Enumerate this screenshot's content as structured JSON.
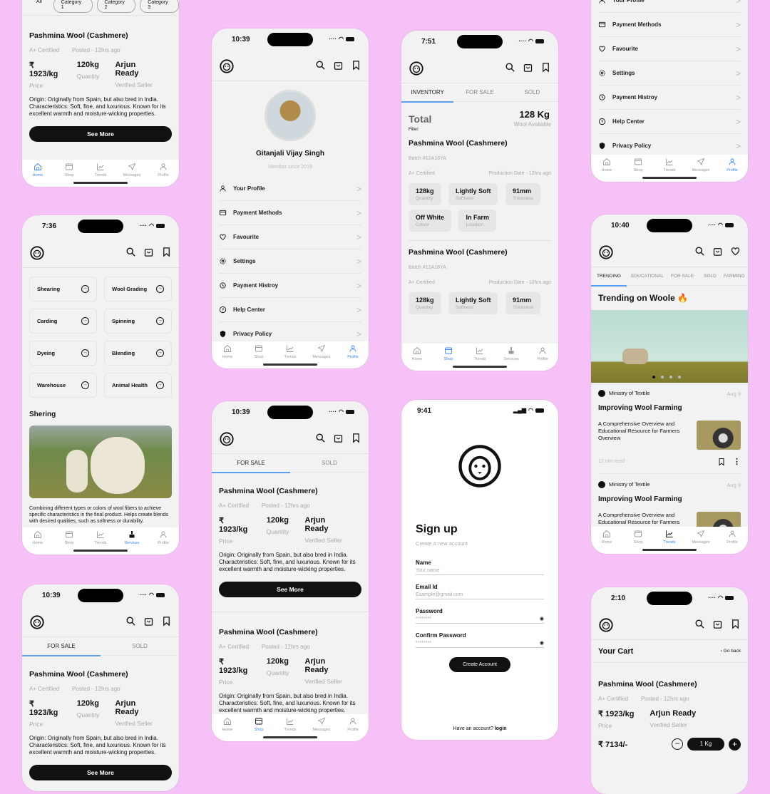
{
  "background_color": "#f6c1f6",
  "accent_color": "#3a86ff",
  "common": {
    "product_title": "Pashmina Wool (Cashmere)",
    "certified": "A+ Certified",
    "posted": "Posted - 12hrs ago",
    "price": "₹ 1923/kg",
    "price_label": "Price",
    "quantity": "120kg",
    "quantity_label": "Quantity",
    "seller": "Arjun Ready",
    "seller_label": "Verified Seller",
    "description": "Origin: Originally from Spain, but also bred in India. Characteristics: Soft, fine, and luxurious. Known for its excellent warmth and moisture-wicking properties.",
    "see_more": "See More",
    "nav": [
      "Home",
      "Shop",
      "Trends",
      "Messages",
      "Profile"
    ],
    "nav_services": [
      "Home",
      "Shop",
      "Trends",
      "Services",
      "Profile"
    ]
  },
  "home_screen": {
    "filter_chips": [
      "All",
      "Category 1",
      "Category 2",
      "Category 3"
    ],
    "active_nav": "Home"
  },
  "profile_screen": {
    "time": "10:39",
    "user_name": "Gitanjali Vijay Singh",
    "member_since": "Member since 2019",
    "menu": [
      "Your Profile",
      "Payment Methods",
      "Favourite",
      "Settings",
      "Payment Histroy",
      "Help Center",
      "Privacy Policy"
    ],
    "active_nav": "Profile"
  },
  "inventory_screen": {
    "time": "7:51",
    "tabs": [
      "INVENTORY",
      "FOR SALE",
      "SOLD"
    ],
    "total_label": "Total",
    "total_value": "128 Kg",
    "total_sub": "Wool Avaliable",
    "filter_label": "Filter:",
    "batch": "Batch #12A16YA",
    "production": "Production Date - 12hrs ago",
    "chips": [
      {
        "value": "128kg",
        "label": "Quantity"
      },
      {
        "value": "Lightly Soft",
        "label": "Softness"
      },
      {
        "value": "91mm",
        "label": "Thickness"
      },
      {
        "value": "Off White",
        "label": "Colour"
      },
      {
        "value": "In Farm",
        "label": "Location"
      }
    ],
    "active_nav": "Shop"
  },
  "services_screen": {
    "time": "7:36",
    "services": [
      "Shearing",
      "Wool Grading",
      "Carding",
      "Spinning",
      "Dyeing",
      "Blending",
      "Warehouse",
      "Animal Health"
    ],
    "section_title": "Shering",
    "section_desc": "Combining different types or colors of wool fibers to achieve specific characteristics in the final product. Helps create blends with desired qualities, such as softness or durability.",
    "active_nav": "Services"
  },
  "forsale_screen": {
    "time": "10:39",
    "tabs": [
      "FOR SALE",
      "SOLD"
    ],
    "active_nav": "Shop"
  },
  "trends_screen": {
    "time": "10:40",
    "tabs": [
      "TRENDING",
      "EDUCATIONAL",
      "FOR SALE",
      "SOLD",
      "FARMING"
    ],
    "heading": "Trending on Woole",
    "source": "Ministry of Textile",
    "date": "Aug 9",
    "article_title": "Improving Wool Farming",
    "article_desc": "A Comprehensive Overview and Educational Resource for Farmers Overview",
    "read_time": "12 min read",
    "active_nav": "Trends"
  },
  "signup_screen": {
    "time": "9:41",
    "title": "Sign up",
    "subtitle": "Create a new account",
    "fields": [
      {
        "label": "Name",
        "placeholder": "Your name"
      },
      {
        "label": "Email Id",
        "placeholder": "Example@gmail.com"
      },
      {
        "label": "Password",
        "placeholder": "********"
      },
      {
        "label": "Confirm Password",
        "placeholder": "********"
      }
    ],
    "create_button": "Create Account",
    "have_account": "Have an account?",
    "login": "login"
  },
  "cart_screen": {
    "time": "2:10",
    "title": "Your Cart",
    "go_back": "Go back",
    "total": "₹ 7134/-",
    "qty": "1 Kg"
  }
}
